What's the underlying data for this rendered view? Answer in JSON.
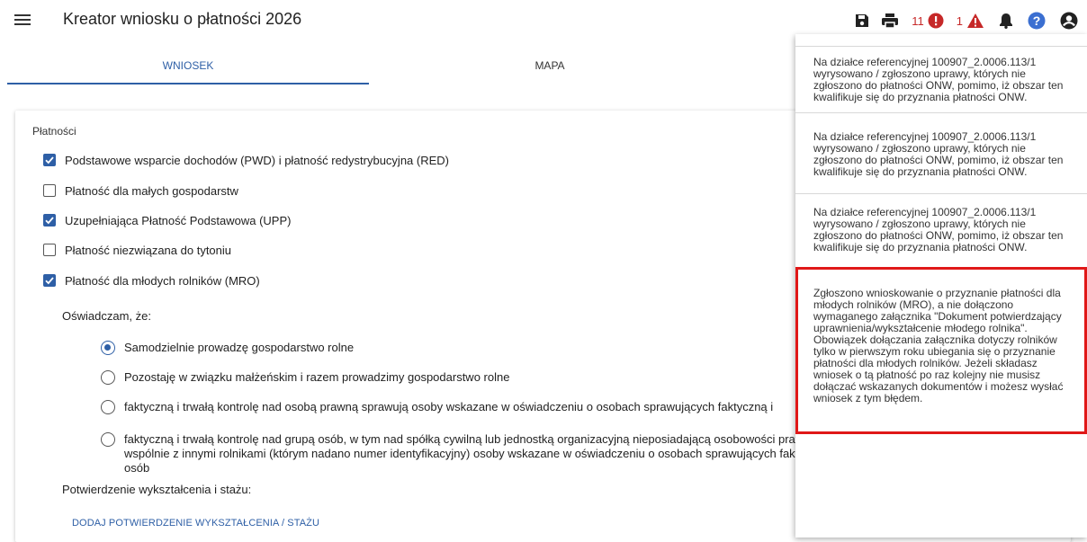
{
  "app": {
    "title": "Kreator wniosku o płatności 2026"
  },
  "toolbar": {
    "icons": [
      "save-icon",
      "print-icon",
      "error-icon",
      "warning-icon",
      "bell-icon",
      "help-icon",
      "account-icon"
    ],
    "error_count": "11",
    "warning_count": "1"
  },
  "tabs": [
    {
      "label": "WNIOSEK",
      "active": true
    },
    {
      "label": "MAPA",
      "active": false
    }
  ],
  "form": {
    "section_label": "Płatności",
    "payments": [
      {
        "label": "Podstawowe wsparcie dochodów (PWD) i płatność redystrybucyjna (RED)",
        "checked": true
      },
      {
        "label": "Płatność dla małych gospodarstw",
        "checked": false
      },
      {
        "label": "Uzupełniająca Płatność Podstawowa (UPP)",
        "checked": true
      },
      {
        "label": "Płatność niezwiązana do tytoniu",
        "checked": false
      },
      {
        "label": "Płatność dla młodych rolników (MRO)",
        "checked": true
      }
    ],
    "declaration_label": "Oświadczam, że:",
    "declarations": [
      {
        "label": "Samodzielnie prowadzę gospodarstwo rolne",
        "selected": true
      },
      {
        "label": "Pozostaję w związku małżeńskim i razem prowadzimy gospodarstwo rolne",
        "selected": false
      },
      {
        "label": "faktyczną i trwałą kontrolę nad osobą prawną sprawują osoby wskazane w oświadczeniu o osobach sprawujących faktyczną i",
        "selected": false
      },
      {
        "label": "faktyczną i trwałą kontrolę nad grupą osób, w tym nad spółką cywilną lub jednostką organizacyjną nieposiadającą osobowości prawnej, sprawują samodzielnie lub wspólnie z innymi rolnikami (którym nadano numer identyfikacyjny) osoby wskazane w oświadczeniu o osobach sprawujących faktyczną i trwałą kontrolę nad grupą osób",
        "selected": false
      }
    ],
    "confirmation_label": "Potwierdzenie wykształcenia i stażu:",
    "add_link": "DODAJ POTWIERDZENIE WYKSZTAŁCENIA / STAŻU"
  },
  "notifications": [
    {
      "text": "Na działce referencyjnej 100907_2.0006.113/1 wyrysowano / zgłoszono uprawy, których nie zgłoszono do płatności ONW, pomimo, iż obszar ten kwalifikuje się do przyznania płatności ONW."
    },
    {
      "text": "Na działce referencyjnej 100907_2.0006.113/1 wyrysowano / zgłoszono uprawy, których nie zgłoszono do płatności ONW, pomimo, iż obszar ten kwalifikuje się do przyznania płatności ONW."
    },
    {
      "text": "Na działce referencyjnej 100907_2.0006.113/1 wyrysowano / zgłoszono uprawy, których nie zgłoszono do płatności ONW, pomimo, iż obszar ten kwalifikuje się do przyznania płatności ONW."
    },
    {
      "text": "Zgłoszono wnioskowanie o przyznanie płatności dla młodych rolników (MRO), a nie dołączono wymaganego załącznika \"Dokument potwierdzający uprawnienia/wykształcenie młodego rolnika\". Obowiązek dołączania załącznika dotyczy rolników tylko w pierwszym roku ubiegania się o przyznanie płatności dla młodych rolników. Jeżeli składasz wniosek o tą płatność po raz kolejny nie musisz dołączać wskazanych dokumentów i możesz wysłać wniosek z tym błędem.",
      "highlighted": true
    }
  ],
  "colors": {
    "accent": "#2e5fa6",
    "error": "#c62828",
    "highlight_border": "#e01818"
  }
}
